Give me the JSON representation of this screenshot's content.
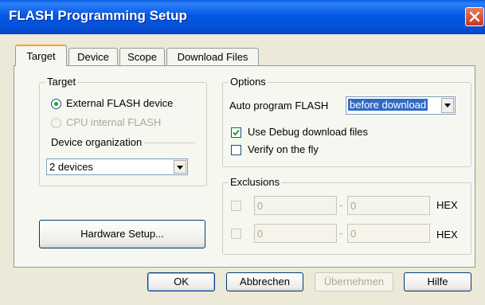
{
  "window": {
    "title": "FLASH Programming Setup"
  },
  "tabs": [
    {
      "label": "Target",
      "active": true
    },
    {
      "label": "Device",
      "active": false
    },
    {
      "label": "Scope",
      "active": false
    },
    {
      "label": "Download Files",
      "active": false
    }
  ],
  "target_group": {
    "legend": "Target",
    "radio_external": {
      "label": "External FLASH device",
      "checked": true,
      "enabled": true
    },
    "radio_internal": {
      "label": "CPU internal FLASH",
      "checked": false,
      "enabled": false
    },
    "device_org_legend": "Device organization",
    "device_org_value": "2 devices"
  },
  "hardware_setup_label": "Hardware Setup...",
  "options_group": {
    "legend": "Options",
    "auto_program_label": "Auto program FLASH",
    "auto_program_value": "before download",
    "use_debug_label": "Use Debug download files",
    "use_debug_checked": true,
    "verify_label": "Verify on the fly",
    "verify_checked": false
  },
  "exclusions_group": {
    "legend": "Exclusions",
    "rows": [
      {
        "from": "0",
        "sep": "-",
        "to": "0",
        "unit": "HEX"
      },
      {
        "from": "0",
        "sep": "-",
        "to": "0",
        "unit": "HEX"
      }
    ]
  },
  "buttons": {
    "ok": "OK",
    "cancel": "Abbrechen",
    "apply": "Übernehmen",
    "help": "Hilfe"
  }
}
